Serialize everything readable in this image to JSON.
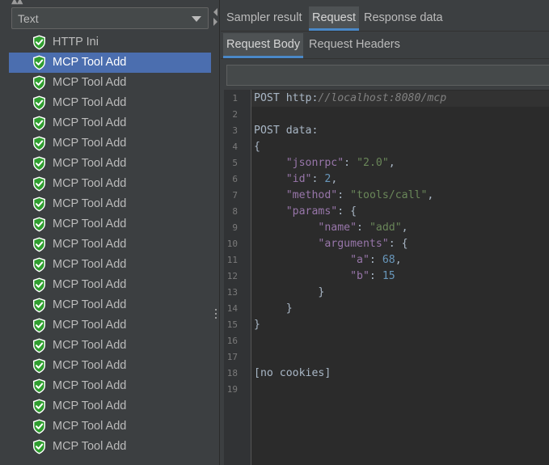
{
  "renderer": {
    "selected": "Text"
  },
  "results": [
    {
      "label": "HTTP Ini",
      "status": "success",
      "selected": false
    },
    {
      "label": "MCP Tool Add",
      "status": "success",
      "selected": true
    },
    {
      "label": "MCP Tool Add",
      "status": "success",
      "selected": false
    },
    {
      "label": "MCP Tool Add",
      "status": "success",
      "selected": false
    },
    {
      "label": "MCP Tool Add",
      "status": "success",
      "selected": false
    },
    {
      "label": "MCP Tool Add",
      "status": "success",
      "selected": false
    },
    {
      "label": "MCP Tool Add",
      "status": "success",
      "selected": false
    },
    {
      "label": "MCP Tool Add",
      "status": "success",
      "selected": false
    },
    {
      "label": "MCP Tool Add",
      "status": "success",
      "selected": false
    },
    {
      "label": "MCP Tool Add",
      "status": "success",
      "selected": false
    },
    {
      "label": "MCP Tool Add",
      "status": "success",
      "selected": false
    },
    {
      "label": "MCP Tool Add",
      "status": "success",
      "selected": false
    },
    {
      "label": "MCP Tool Add",
      "status": "success",
      "selected": false
    },
    {
      "label": "MCP Tool Add",
      "status": "success",
      "selected": false
    },
    {
      "label": "MCP Tool Add",
      "status": "success",
      "selected": false
    },
    {
      "label": "MCP Tool Add",
      "status": "success",
      "selected": false
    },
    {
      "label": "MCP Tool Add",
      "status": "success",
      "selected": false
    },
    {
      "label": "MCP Tool Add",
      "status": "success",
      "selected": false
    },
    {
      "label": "MCP Tool Add",
      "status": "success",
      "selected": false
    },
    {
      "label": "MCP Tool Add",
      "status": "success",
      "selected": false
    },
    {
      "label": "MCP Tool Add",
      "status": "success",
      "selected": false
    }
  ],
  "tabs": {
    "main": [
      "Sampler result",
      "Request",
      "Response data"
    ],
    "main_active": "Request",
    "sub": [
      "Request Body",
      "Request Headers"
    ],
    "sub_active": "Request Body"
  },
  "search": {
    "value": ""
  },
  "editor": {
    "lines": [
      {
        "n": "1",
        "tokens": [
          [
            "fg",
            "POST "
          ],
          [
            "fg",
            "http:"
          ],
          [
            "url",
            "//localhost:8080/mcp"
          ]
        ]
      },
      {
        "n": "2",
        "tokens": []
      },
      {
        "n": "3",
        "tokens": [
          [
            "fg",
            "POST data:"
          ]
        ]
      },
      {
        "n": "4",
        "tokens": [
          [
            "fg",
            "{"
          ]
        ]
      },
      {
        "n": "5",
        "tokens": [
          [
            "fg",
            "     "
          ],
          [
            "key",
            "\"jsonrpc\""
          ],
          [
            "fg",
            ": "
          ],
          [
            "str",
            "\"2.0\""
          ],
          [
            "fg",
            ","
          ]
        ]
      },
      {
        "n": "6",
        "tokens": [
          [
            "fg",
            "     "
          ],
          [
            "key",
            "\"id\""
          ],
          [
            "fg",
            ": "
          ],
          [
            "num",
            "2"
          ],
          [
            "fg",
            ","
          ]
        ]
      },
      {
        "n": "7",
        "tokens": [
          [
            "fg",
            "     "
          ],
          [
            "key",
            "\"method\""
          ],
          [
            "fg",
            ": "
          ],
          [
            "str",
            "\"tools/call\""
          ],
          [
            "fg",
            ","
          ]
        ]
      },
      {
        "n": "8",
        "tokens": [
          [
            "fg",
            "     "
          ],
          [
            "key",
            "\"params\""
          ],
          [
            "fg",
            ": {"
          ]
        ]
      },
      {
        "n": "9",
        "tokens": [
          [
            "fg",
            "          "
          ],
          [
            "key",
            "\"name\""
          ],
          [
            "fg",
            ": "
          ],
          [
            "str",
            "\"add\""
          ],
          [
            "fg",
            ","
          ]
        ]
      },
      {
        "n": "10",
        "tokens": [
          [
            "fg",
            "          "
          ],
          [
            "key",
            "\"arguments\""
          ],
          [
            "fg",
            ": {"
          ]
        ]
      },
      {
        "n": "11",
        "tokens": [
          [
            "fg",
            "               "
          ],
          [
            "key",
            "\"a\""
          ],
          [
            "fg",
            ": "
          ],
          [
            "num",
            "68"
          ],
          [
            "fg",
            ","
          ]
        ]
      },
      {
        "n": "12",
        "tokens": [
          [
            "fg",
            "               "
          ],
          [
            "key",
            "\"b\""
          ],
          [
            "fg",
            ": "
          ],
          [
            "num",
            "15"
          ]
        ]
      },
      {
        "n": "13",
        "tokens": [
          [
            "fg",
            "          }"
          ]
        ]
      },
      {
        "n": "14",
        "tokens": [
          [
            "fg",
            "     }"
          ]
        ]
      },
      {
        "n": "15",
        "tokens": [
          [
            "fg",
            "}"
          ]
        ]
      },
      {
        "n": "16",
        "tokens": []
      },
      {
        "n": "17",
        "tokens": []
      },
      {
        "n": "18",
        "tokens": [
          [
            "fg",
            "[no cookies]"
          ]
        ]
      },
      {
        "n": "19",
        "tokens": []
      }
    ]
  },
  "colors": {
    "selection": "#4b6eaf",
    "success_shield": "#2f9e2f",
    "tab_underline": "#4a88c7",
    "json_key": "#9876aa",
    "json_string": "#6a8759",
    "json_number": "#6897bb"
  },
  "icons": {
    "result_status": "shield-check-icon"
  }
}
